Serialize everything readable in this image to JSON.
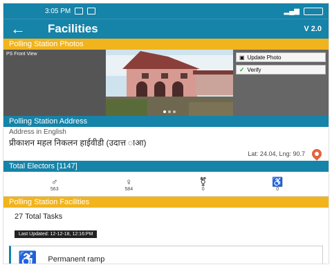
{
  "status_bar": {
    "time": "3:05 PM",
    "icons": [
      "message-icon",
      "settings-icon"
    ],
    "battery_icon": "battery-icon"
  },
  "app_bar": {
    "back_label": "←",
    "title": "Facilities",
    "version": "V 2.0"
  },
  "photos_section": {
    "header": "Polling Station Photos",
    "left_label": "PS Front View",
    "buttons": [
      {
        "label": "Update Photo"
      },
      {
        "label": "Verify"
      }
    ]
  },
  "address_section": {
    "header": "Polling Station Address",
    "address_label": "Address in English",
    "address_text": "प्रीकाशन महल निकलन हाईवीडी (उदात्त ाआ)",
    "lat_lng": "Lat: 24.04, Lng: 90.7"
  },
  "electors": {
    "header": "Total Electors [1147]",
    "items": [
      {
        "icon": "male-icon",
        "label": "563"
      },
      {
        "icon": "female-icon",
        "label": "584"
      },
      {
        "icon": "third-gender-icon",
        "label": "0"
      },
      {
        "icon": "pwd-icon",
        "label": "0"
      }
    ]
  },
  "facilities": {
    "header": "Polling Station Facilities",
    "total_tasks": "27 Total Tasks",
    "progress_text": "Last Updated: 12-12-18, 12:16:PM",
    "items": [
      {
        "icon": "wheelchair-icon",
        "label": "Permanent ramp"
      }
    ]
  },
  "colors": {
    "primary": "#1683a8",
    "accent": "#f2b41c",
    "pin": "#e5623c"
  }
}
